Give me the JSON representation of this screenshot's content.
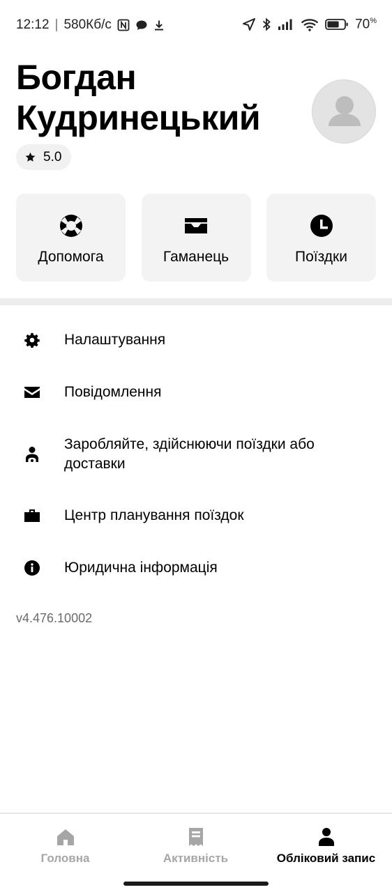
{
  "status_bar": {
    "time": "12:12",
    "separator": "|",
    "network_speed": "580Кб/с",
    "battery_percent": "70",
    "battery_unit": "%",
    "battery_level": 0.7,
    "icons": [
      "nfc-icon",
      "chat-bubble-icon",
      "download-icon",
      "location-arrow-icon",
      "bluetooth-icon",
      "signal-icon",
      "wifi-icon",
      "battery-icon"
    ]
  },
  "profile": {
    "name": "Богдан Кудринецький",
    "rating": "5.0",
    "rating_icon": "star-icon",
    "avatar_icon": "person-placeholder-icon"
  },
  "quick_actions": [
    {
      "label": "Допомога",
      "icon": "lifebuoy-icon"
    },
    {
      "label": "Гаманець",
      "icon": "wallet-icon"
    },
    {
      "label": "Поїздки",
      "icon": "clock-icon"
    }
  ],
  "menu": [
    {
      "label": "Налаштування",
      "icon": "gear-icon"
    },
    {
      "label": "Повідомлення",
      "icon": "envelope-icon"
    },
    {
      "label": "Заробляйте, здійснюючи поїздки або доставки",
      "icon": "driver-icon"
    },
    {
      "label": "Центр планування поїздок",
      "icon": "briefcase-icon"
    },
    {
      "label": "Юридична інформація",
      "icon": "info-icon"
    }
  ],
  "version": "v4.476.10002",
  "bottom_nav": [
    {
      "label": "Головна",
      "icon": "home-icon",
      "active": false
    },
    {
      "label": "Активність",
      "icon": "receipt-icon",
      "active": false
    },
    {
      "label": "Обліковий запис",
      "icon": "person-icon",
      "active": true
    }
  ],
  "colors": {
    "background": "#ffffff",
    "tile_background": "#f3f3f3",
    "inactive_nav": "#a6a6a6",
    "text": "#000000"
  }
}
